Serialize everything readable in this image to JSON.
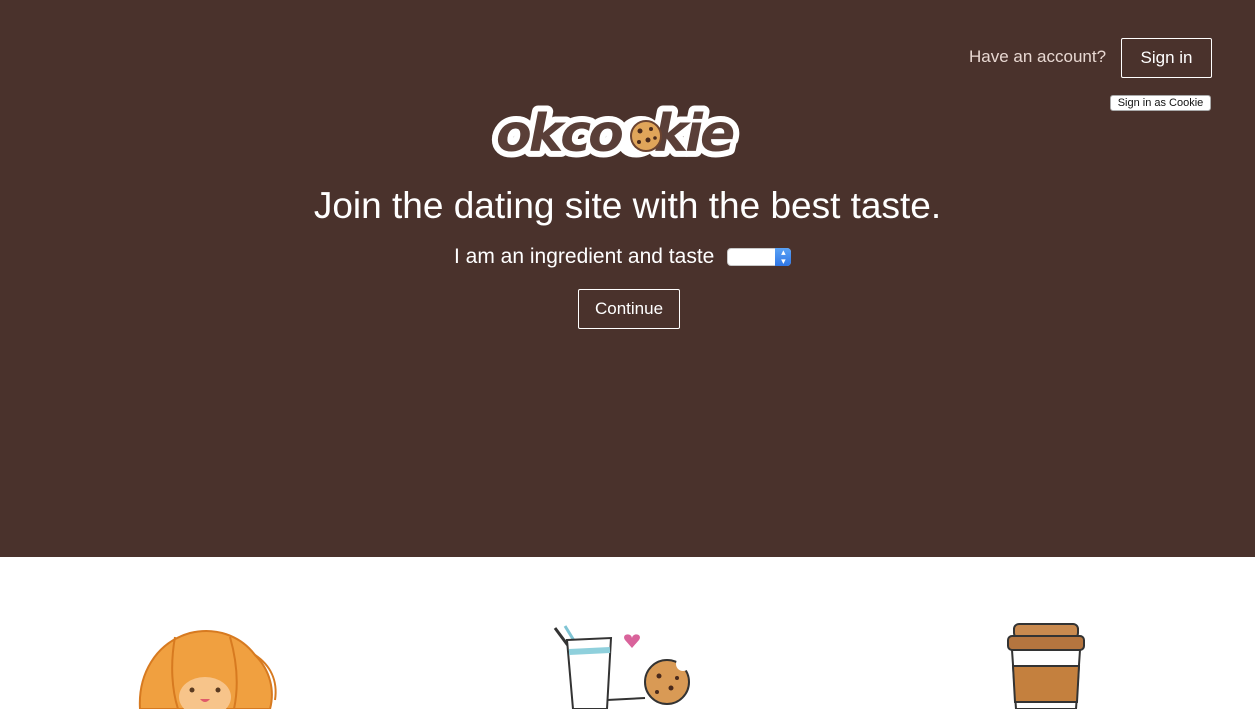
{
  "header": {
    "account_prompt": "Have an account?",
    "sign_in_label": "Sign in",
    "sign_in_cookie_label": "Sign in as Cookie"
  },
  "logo": {
    "text_before": "okco",
    "text_after": "kie"
  },
  "hero": {
    "tagline": "Join the dating site with the best taste.",
    "prompt_label": "I am an ingredient and taste",
    "taste_select_value": "",
    "continue_label": "Continue"
  },
  "colors": {
    "hero_background": "#4a322c",
    "logo_brown": "#5a3f38",
    "accent_blue": "#2f76e6"
  },
  "illustrations": [
    "croissant-illustration",
    "milk-and-cookie-illustration",
    "coffee-cup-illustration"
  ]
}
